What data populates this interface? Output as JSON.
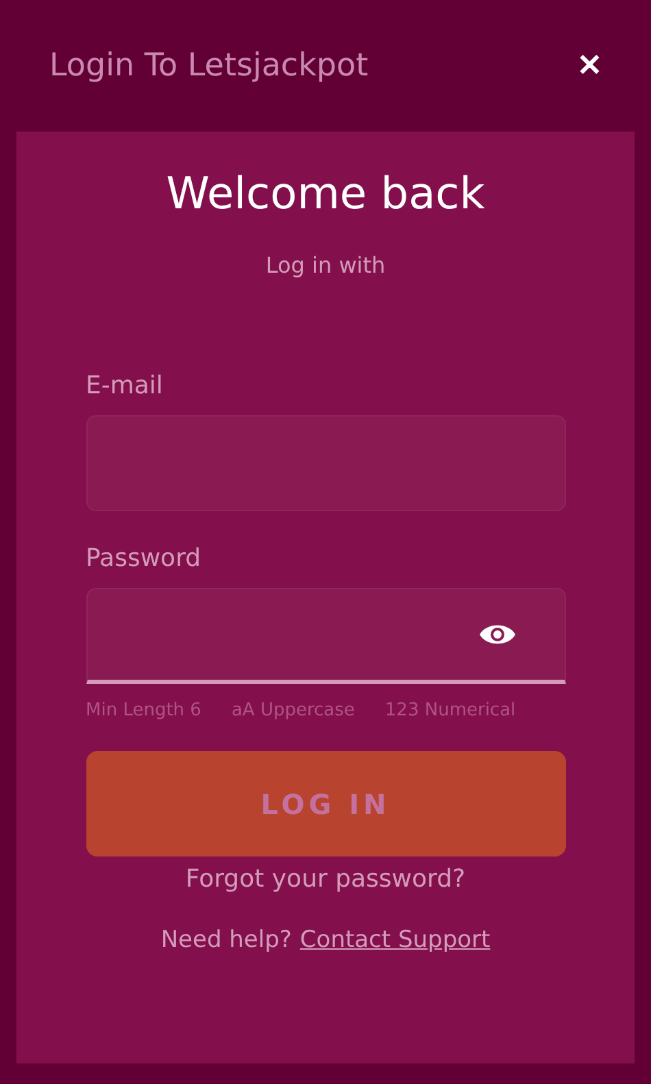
{
  "header": {
    "title": "Login To Letsjackpot",
    "close": "✕"
  },
  "form": {
    "heading": "Welcome back",
    "subheading": "Log in with",
    "fields": [
      {
        "kind": "email",
        "label": "E-mail"
      },
      {
        "kind": "password",
        "label": "Password"
      }
    ],
    "hints": [
      "Min Length 6",
      "aA Uppercase",
      "123 Numerical"
    ],
    "submit": {
      "label": "LOG IN",
      "disabled": true
    },
    "forgot": "Forgot your password?",
    "help": {
      "text": "Need help?",
      "link": "Contact Support"
    }
  }
}
